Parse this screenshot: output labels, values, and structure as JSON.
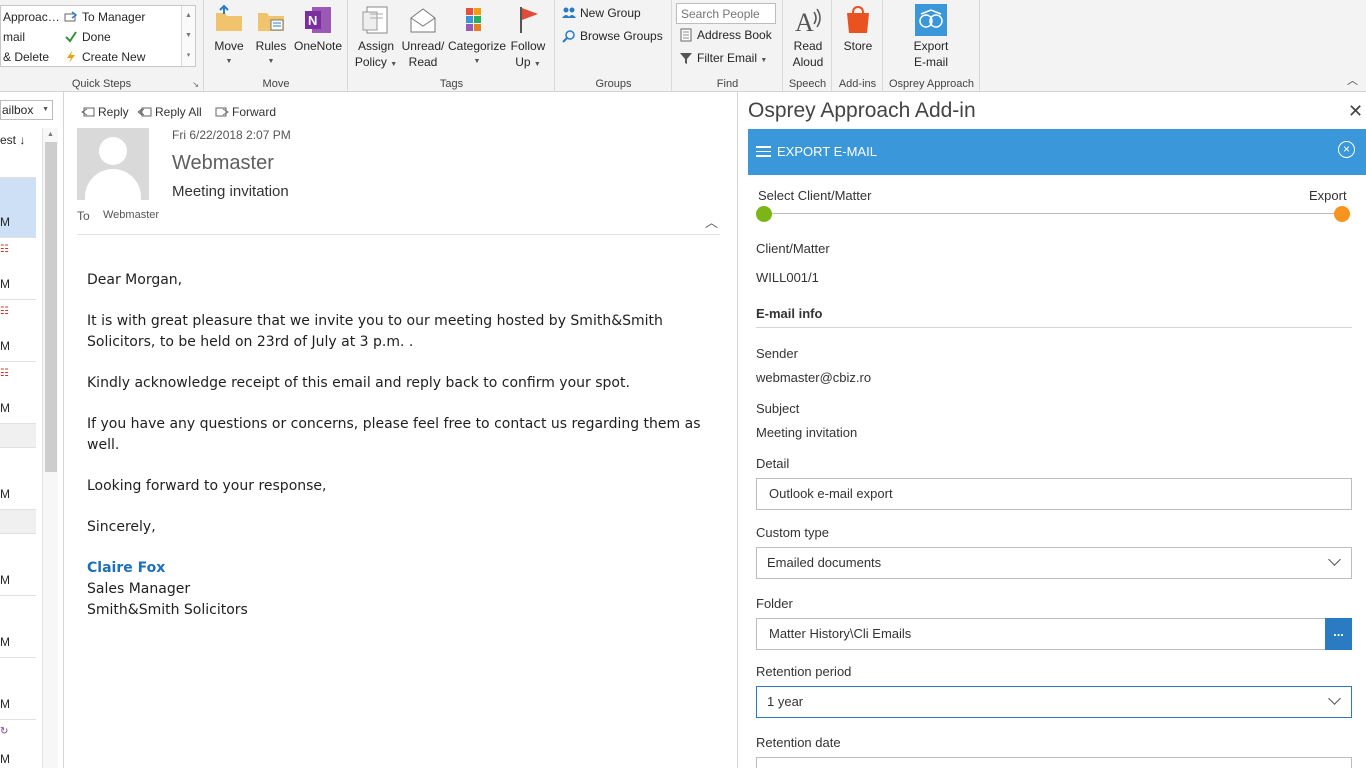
{
  "ribbon": {
    "quick_steps": {
      "items": [
        "Approac…",
        "To Manager",
        "mail",
        "Done",
        "& Delete",
        "Create New"
      ],
      "group_label": "Quick Steps"
    },
    "move": {
      "move_label": "Move",
      "rules_label": "Rules",
      "onenote_label": "OneNote",
      "group_label": "Move"
    },
    "tags": {
      "assign_policy_line1": "Assign",
      "assign_policy_line2": "Policy",
      "unread_line1": "Unread/",
      "unread_line2": "Read",
      "categorize_label": "Categorize",
      "follow_up_line1": "Follow",
      "follow_up_line2": "Up",
      "group_label": "Tags"
    },
    "groups": {
      "new_group": "New Group",
      "browse_groups": "Browse Groups",
      "group_label": "Groups"
    },
    "find": {
      "search_placeholder": "Search People",
      "address_book": "Address Book",
      "filter_email": "Filter Email",
      "group_label": "Find"
    },
    "speech": {
      "read_line1": "Read",
      "read_line2": "Aloud",
      "group_label": "Speech"
    },
    "addins": {
      "store_label": "Store",
      "group_label": "Add-ins"
    },
    "osprey": {
      "export_line1": "Export",
      "export_line2": "E-mail",
      "group_label": "Osprey Approach"
    }
  },
  "maillist": {
    "mailbox_label": "ailbox",
    "sort_label": "est ↓",
    "rows": [
      "M",
      "M",
      "M",
      "M",
      "M",
      "M",
      "M",
      "M",
      "M"
    ]
  },
  "message": {
    "actions": {
      "reply": "Reply",
      "reply_all": "Reply All",
      "forward": "Forward"
    },
    "date": "Fri 6/22/2018 2:07 PM",
    "from": "Webmaster",
    "subject": "Meeting invitation",
    "to_label": "To",
    "to_name": "Webmaster",
    "body": {
      "greeting": "Dear Morgan,",
      "p1": "It is with great pleasure that we invite you to our meeting hosted by Smith&Smith Solicitors, to be held on 23rd of July at 3 p.m. .",
      "p2": "Kindly acknowledge receipt of this email and reply back to confirm your spot.",
      "p3": "If you have any questions or concerns, please feel free to contact us regarding them as well.",
      "p4": "Looking forward to your response,",
      "closing": "Sincerely,",
      "sig_name": "Claire Fox",
      "sig_title": "Sales Manager",
      "sig_company": "Smith&Smith Solicitors"
    }
  },
  "addin": {
    "title": "Osprey Approach Add-in",
    "close": "✕",
    "bar_title": "EXPORT E-MAIL",
    "steps": {
      "start": "Select Client/Matter",
      "end": "Export",
      "start_color": "#7cb518",
      "end_color": "#f7941d"
    },
    "client_matter_label": "Client/Matter",
    "client_matter_value": "WILL001/1",
    "email_info_heading": "E-mail info",
    "sender_label": "Sender",
    "sender_value": "webmaster@cbiz.ro",
    "subject_label": "Subject",
    "subject_value": "Meeting invitation",
    "detail_label": "Detail",
    "detail_value": "Outlook e-mail export",
    "custom_type_label": "Custom type",
    "custom_type_value": "Emailed documents",
    "folder_label": "Folder",
    "folder_value": "Matter History\\Cli Emails",
    "folder_browse": "...",
    "retention_period_label": "Retention period",
    "retention_period_value": "1 year",
    "retention_date_label": "Retention date"
  }
}
